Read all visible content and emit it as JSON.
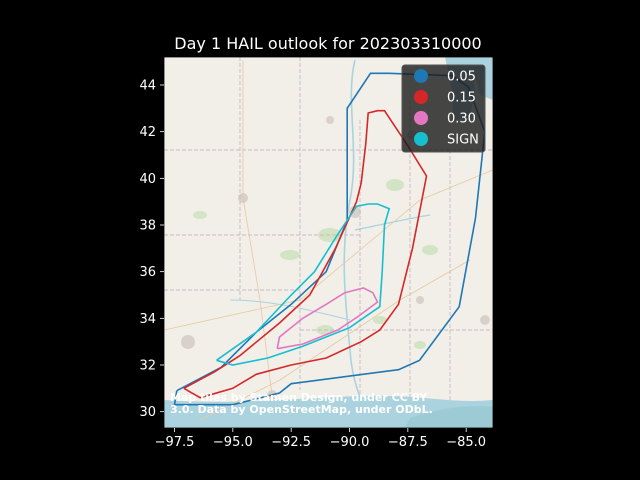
{
  "chart_data": {
    "type": "line",
    "title": "Day 1 HAIL outlook for 202303310000",
    "xlim": [
      -97.95,
      -83.85
    ],
    "ylim": [
      29.3,
      45.2
    ],
    "xticks": [
      -97.5,
      -95.0,
      -92.5,
      -90.0,
      -87.5,
      -85.0
    ],
    "xtick_labels": [
      "−97.5",
      "−95.0",
      "−92.5",
      "−90.0",
      "−87.5",
      "−85.0"
    ],
    "yticks": [
      30,
      32,
      34,
      36,
      38,
      40,
      42,
      44
    ],
    "ytick_labels": [
      "30",
      "32",
      "34",
      "36",
      "38",
      "40",
      "42",
      "44"
    ],
    "legend_position": "top-right",
    "attribution": "Map tiles by Stamen Design, under CC BY 3.0. Data by OpenStreetMap, under ODbL.",
    "series": [
      {
        "name": "0.05",
        "color": "#1f77b4",
        "points": [
          [
            -97.4,
            30.9
          ],
          [
            -97.5,
            30.3
          ],
          [
            -95.0,
            30.3
          ],
          [
            -93.0,
            30.8
          ],
          [
            -92.5,
            31.2
          ],
          [
            -87.9,
            31.8
          ],
          [
            -87.0,
            32.2
          ],
          [
            -85.3,
            34.5
          ],
          [
            -84.6,
            38.3
          ],
          [
            -84.2,
            42.0
          ],
          [
            -84.9,
            43.9
          ],
          [
            -85.6,
            44.4
          ],
          [
            -88.3,
            44.5
          ],
          [
            -89.1,
            44.5
          ],
          [
            -90.1,
            43.0
          ],
          [
            -90.1,
            38.2
          ],
          [
            -91.0,
            36.0
          ],
          [
            -92.5,
            34.6
          ],
          [
            -94.0,
            33.4
          ],
          [
            -95.5,
            31.9
          ],
          [
            -97.4,
            30.9
          ]
        ]
      },
      {
        "name": "0.15",
        "color": "#d62728",
        "points": [
          [
            -97.1,
            31.0
          ],
          [
            -96.4,
            30.6
          ],
          [
            -95.0,
            31.0
          ],
          [
            -94.0,
            31.6
          ],
          [
            -92.5,
            32.0
          ],
          [
            -91.0,
            32.3
          ],
          [
            -89.5,
            33.0
          ],
          [
            -88.7,
            33.5
          ],
          [
            -87.9,
            34.6
          ],
          [
            -87.3,
            37.0
          ],
          [
            -86.7,
            40.1
          ],
          [
            -87.5,
            41.4
          ],
          [
            -88.5,
            42.9
          ],
          [
            -88.8,
            42.9
          ],
          [
            -89.2,
            42.8
          ],
          [
            -89.3,
            41.5
          ],
          [
            -89.5,
            39.8
          ],
          [
            -89.7,
            39.0
          ],
          [
            -90.6,
            37.0
          ],
          [
            -91.7,
            35.0
          ],
          [
            -93.0,
            33.8
          ],
          [
            -94.7,
            32.4
          ],
          [
            -95.8,
            31.7
          ],
          [
            -97.1,
            31.0
          ]
        ]
      },
      {
        "name": "0.30",
        "color": "#e377c2",
        "points": [
          [
            -93.1,
            32.7
          ],
          [
            -92.0,
            32.9
          ],
          [
            -90.5,
            33.5
          ],
          [
            -89.6,
            34.1
          ],
          [
            -88.8,
            34.7
          ],
          [
            -89.0,
            35.1
          ],
          [
            -89.4,
            35.3
          ],
          [
            -90.2,
            35.1
          ],
          [
            -91.0,
            34.6
          ],
          [
            -92.0,
            34.0
          ],
          [
            -93.0,
            33.2
          ],
          [
            -93.1,
            32.7
          ]
        ]
      },
      {
        "name": "SIGN",
        "color": "#17becf",
        "points": [
          [
            -95.7,
            32.2
          ],
          [
            -95.0,
            32.0
          ],
          [
            -93.5,
            32.3
          ],
          [
            -92.0,
            32.8
          ],
          [
            -90.0,
            33.6
          ],
          [
            -88.7,
            34.5
          ],
          [
            -88.6,
            36.0
          ],
          [
            -88.5,
            38.0
          ],
          [
            -88.3,
            38.7
          ],
          [
            -88.8,
            38.9
          ],
          [
            -89.2,
            38.9
          ],
          [
            -89.7,
            38.8
          ],
          [
            -90.5,
            37.6
          ],
          [
            -91.5,
            36.0
          ],
          [
            -92.5,
            35.0
          ],
          [
            -94.0,
            33.4
          ],
          [
            -95.7,
            32.2
          ]
        ]
      }
    ]
  }
}
